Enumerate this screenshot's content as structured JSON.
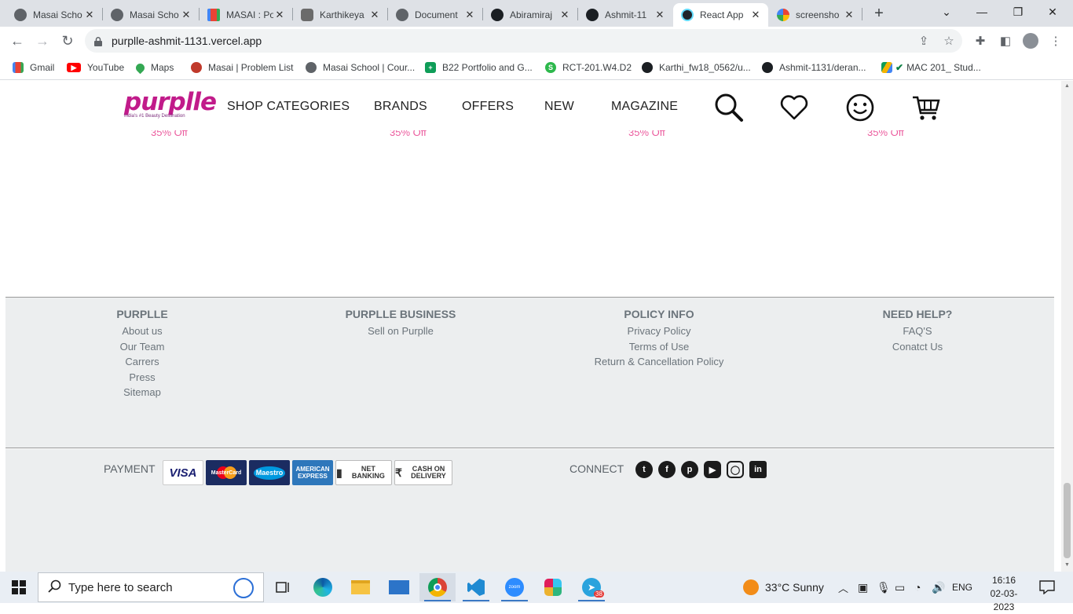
{
  "browser": {
    "tabs": [
      {
        "title": "Masai Scho",
        "favicon": "globe-icon"
      },
      {
        "title": "Masai Scho",
        "favicon": "globe-icon"
      },
      {
        "title": "MASAI : Po",
        "favicon": "gmail-icon"
      },
      {
        "title": "Karthikeya",
        "favicon": "person-icon"
      },
      {
        "title": "Document",
        "favicon": "globe-icon"
      },
      {
        "title": "Abiramiraj",
        "favicon": "github-icon"
      },
      {
        "title": "Ashmit-11",
        "favicon": "github-icon"
      },
      {
        "title": "React App",
        "favicon": "react-icon",
        "active": true
      },
      {
        "title": "screensho",
        "favicon": "google-icon"
      }
    ],
    "new_tab_label": "+",
    "url": "purplle-ashmit-1131.vercel.app",
    "bookmarks": [
      {
        "label": "Gmail",
        "icon": "gmail-icon"
      },
      {
        "label": "YouTube",
        "icon": "youtube-icon"
      },
      {
        "label": "Maps",
        "icon": "maps-icon"
      },
      {
        "label": "Masai | Problem List",
        "icon": "masai-icon"
      },
      {
        "label": "Masai School | Cour...",
        "icon": "globe-icon"
      },
      {
        "label": "B22 Portfolio and G...",
        "icon": "sheets-icon"
      },
      {
        "label": "RCT-201.W4.D2",
        "icon": "s-icon"
      },
      {
        "label": "Karthi_fw18_0562/u...",
        "icon": "github-icon"
      },
      {
        "label": "Ashmit-1131/deran...",
        "icon": "github-icon"
      },
      {
        "label": "MAC 201_ Stud...",
        "icon": "drive-icon"
      }
    ]
  },
  "site": {
    "logo_text": "purplle",
    "logo_tagline": "India's #1 Beauty Destination",
    "nav": [
      "SHOP CATEGORIES",
      "BRANDS",
      "OFFERS",
      "NEW",
      "MAGAZINE"
    ],
    "offer_peek": [
      "35% Off",
      "35% Off",
      "35% Off",
      "35% Off"
    ],
    "footer_columns": [
      {
        "heading": "PURPLLE",
        "links": [
          "About us",
          "Our Team",
          "Carrers",
          "Press",
          "Sitemap"
        ]
      },
      {
        "heading": "PURPLLE BUSINESS",
        "links": [
          "Sell on Purplle"
        ]
      },
      {
        "heading": "POLICY INFO",
        "links": [
          "Privacy Policy",
          "Terms of Use",
          "Return & Cancellation Policy"
        ]
      },
      {
        "heading": "NEED HELP?",
        "links": [
          "FAQ'S",
          "Conatct Us"
        ]
      }
    ],
    "payment_label": "PAYMENT",
    "payment_methods": [
      "VISA",
      "MasterCard",
      "Maestro",
      "AMERICAN EXPRESS",
      "NET BANKING",
      "CASH ON DELIVERY"
    ],
    "connect_label": "CONNECT",
    "social": [
      "twitter-icon",
      "facebook-icon",
      "pinterest-icon",
      "youtube-icon",
      "instagram-icon",
      "linkedin-icon"
    ]
  },
  "taskbar": {
    "search_placeholder": "Type here to search",
    "weather": "33°C  Sunny",
    "language": "ENG",
    "time": "16:16",
    "date": "02-03-2023",
    "telegram_badge": "38"
  }
}
